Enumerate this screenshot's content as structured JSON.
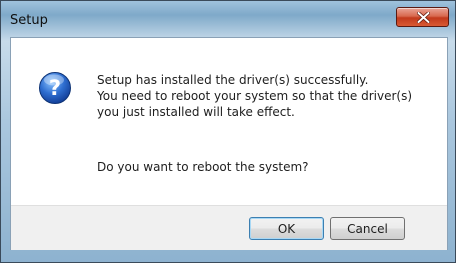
{
  "window": {
    "title": "Setup"
  },
  "message": {
    "lines": [
      "Setup has installed the driver(s) successfully.",
      "You need to reboot your system so that the driver(s)",
      "you just installed will take effect."
    ],
    "question": "Do you want to reboot the system?"
  },
  "buttons": {
    "ok_label": "OK",
    "cancel_label": "Cancel"
  },
  "icons": {
    "dialog_icon": "question-icon",
    "close_icon": "close-icon"
  },
  "colors": {
    "close_button": "#c23a1c",
    "question_icon": "#1f5bb8"
  }
}
